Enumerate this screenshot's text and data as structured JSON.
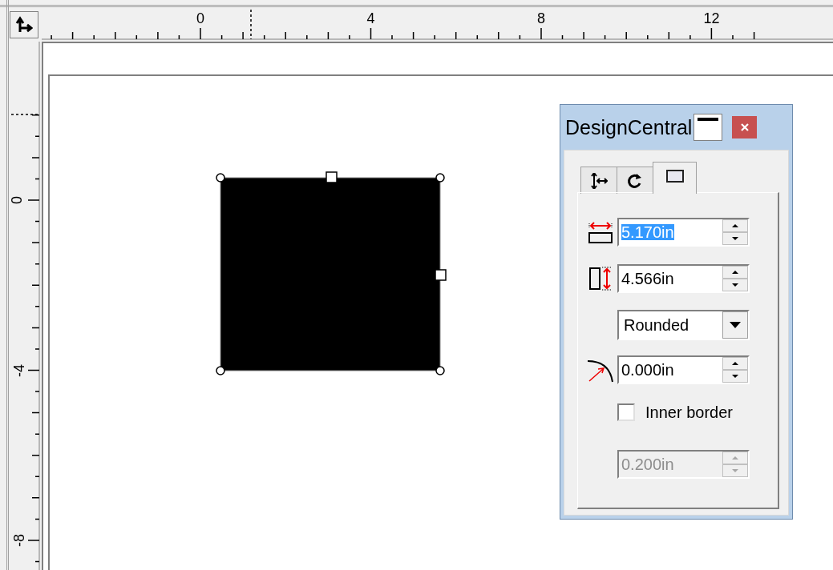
{
  "ruler_top": {
    "labels": [
      "0",
      "4",
      "8",
      "12"
    ]
  },
  "ruler_left": {
    "labels": [
      "0",
      "-4",
      "-8"
    ]
  },
  "dialog": {
    "title": "DesignCentral",
    "tabs": [
      {
        "selected": false
      },
      {
        "selected": false
      },
      {
        "selected": true
      }
    ],
    "controls": [
      {
        "kind": "spin",
        "value": "5.170in",
        "highlighted": true,
        "disabled": false
      },
      {
        "kind": "spin",
        "value": "4.566in",
        "highlighted": false,
        "disabled": false
      },
      {
        "kind": "dropdown",
        "value": "Rounded"
      },
      {
        "kind": "spin",
        "value": "0.000in",
        "highlighted": false,
        "disabled": false
      },
      {
        "kind": "checkbox",
        "label": "Inner border",
        "checked": false
      },
      {
        "kind": "spin",
        "value": "0.200in",
        "highlighted": false,
        "disabled": true
      }
    ]
  }
}
